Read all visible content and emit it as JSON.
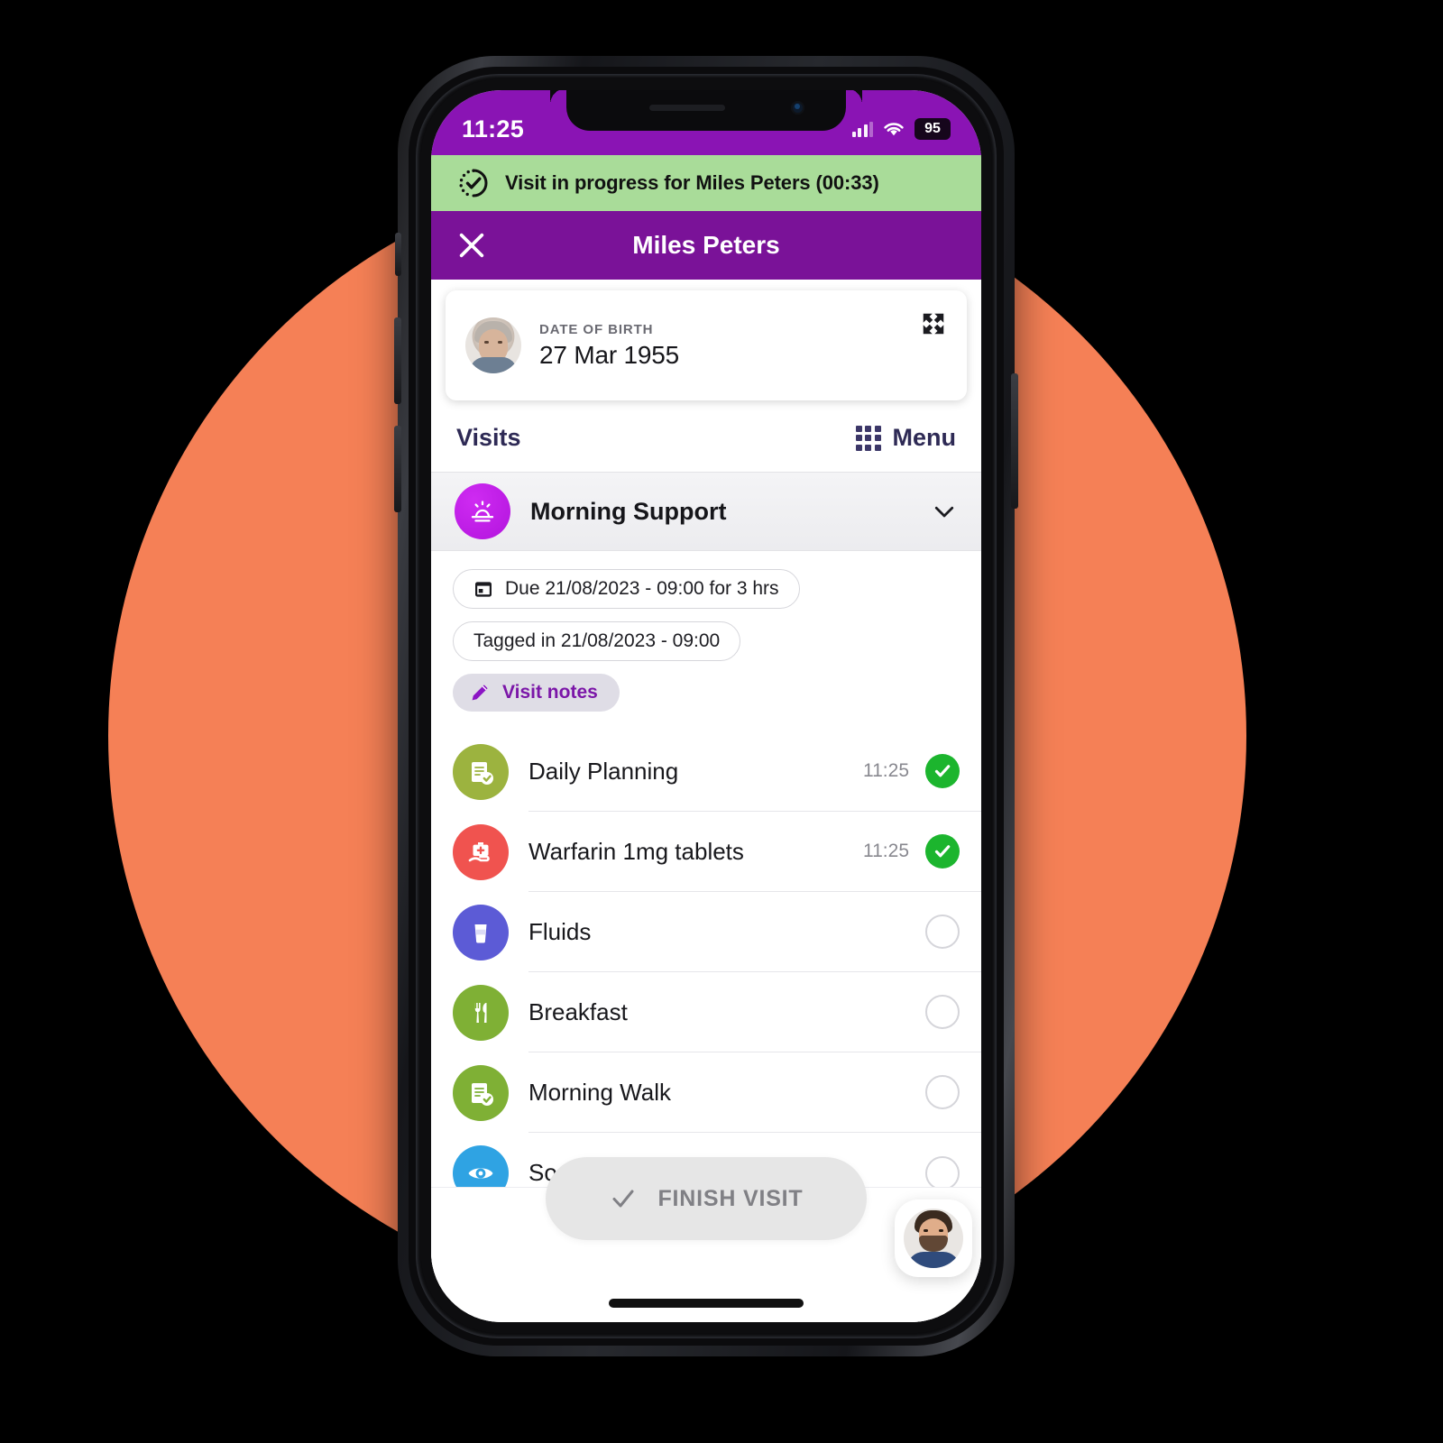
{
  "device": {
    "status_bar": {
      "time": "11:25",
      "battery_level": "95",
      "signal_icon": "signal-bars-icon",
      "wifi_icon": "wifi-icon"
    },
    "home_indicator": "home-indicator"
  },
  "banner": {
    "icon": "visit-in-progress-icon",
    "text": "Visit in progress for Miles Peters (00:33)",
    "background": "#A9DC99"
  },
  "appbar": {
    "close_icon": "close-icon",
    "title": "Miles Peters",
    "background": "#7A1298"
  },
  "patient_card": {
    "avatar": "patient-photo",
    "dob_label": "DATE OF BIRTH",
    "dob_value": "27 Mar 1955",
    "expand_icon": "expand-icon"
  },
  "visits_section": {
    "title": "Visits",
    "menu_label": "Menu",
    "menu_icon": "grid-menu-icon"
  },
  "visit": {
    "icon": "sunrise-icon",
    "icon_color": "#C11FE8",
    "name": "Morning Support",
    "chevron_icon": "chevron-down-icon",
    "chips": [
      {
        "icon": "calendar-icon",
        "label": "Due 21/08/2023 - 09:00 for 3 hrs",
        "style": "outline"
      },
      {
        "icon": "",
        "label": "Tagged in 21/08/2023 - 09:00",
        "style": "outline"
      },
      {
        "icon": "pencil-icon",
        "label": "Visit notes",
        "style": "filled"
      }
    ]
  },
  "tasks": [
    {
      "icon": "clipboard-check-icon",
      "icon_color": "#9CB33F",
      "label": "Daily Planning",
      "time": "11:25",
      "done": true
    },
    {
      "icon": "medication-hand-icon",
      "icon_color": "#F0534F",
      "label": "Warfarin 1mg tablets",
      "time": "11:25",
      "done": true
    },
    {
      "icon": "drink-glass-icon",
      "icon_color": "#5C5BD6",
      "label": "Fluids",
      "time": "",
      "done": false
    },
    {
      "icon": "cutlery-icon",
      "icon_color": "#7FB035",
      "label": "Breakfast",
      "time": "",
      "done": false
    },
    {
      "icon": "clipboard-check-icon",
      "icon_color": "#7FB035",
      "label": "Morning Walk",
      "time": "",
      "done": false
    },
    {
      "icon": "eye-icon",
      "icon_color": "#2FA3E3",
      "label": "Social Activities",
      "time": "",
      "done": false
    }
  ],
  "bottom": {
    "finish_label": "FINISH VISIT",
    "finish_icon": "check-icon",
    "fab_icon": "carer-avatar"
  },
  "theme": {
    "purple": "#7A1298",
    "status_purple": "#8A14B4",
    "green": "#A9DC99",
    "orange_backdrop": "#F58056",
    "done_green": "#1CB52E",
    "navy": "#2E2A55"
  }
}
